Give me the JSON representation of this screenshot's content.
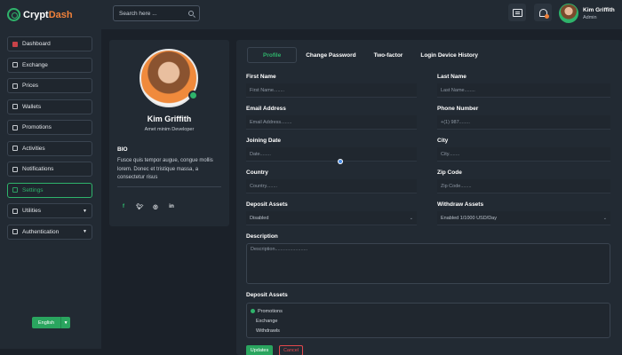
{
  "brand": {
    "prefix": "Crypt",
    "suffix": "Dash"
  },
  "search": {
    "placeholder": "Search here ..."
  },
  "header": {
    "user_name": "Kim Griffith",
    "user_role": "Admin"
  },
  "sidebar": {
    "items": [
      {
        "label": "Dashboard",
        "icon": "dashboard-icon"
      },
      {
        "label": "Exchange",
        "icon": "exchange-icon"
      },
      {
        "label": "Prices",
        "icon": "prices-icon"
      },
      {
        "label": "Wallets",
        "icon": "wallet-icon"
      },
      {
        "label": "Promotions",
        "icon": "percent-icon"
      },
      {
        "label": "Activities",
        "icon": "activity-icon"
      },
      {
        "label": "Notifications",
        "icon": "bell-icon"
      },
      {
        "label": "Settings",
        "icon": "settings-icon",
        "active": true
      },
      {
        "label": "Utilities",
        "icon": "utilities-icon"
      },
      {
        "label": "Authentication",
        "icon": "lock-icon"
      }
    ],
    "language": "English"
  },
  "profile": {
    "name": "Kim Griffith",
    "role": "Amet minim Developer",
    "bio_label": "BIO",
    "bio": "Fusce quis tempor augue, congue mollis lorem. Donec et tristique massa, a consectetur risus",
    "socials": [
      "f",
      "t",
      "ig",
      "in"
    ]
  },
  "tabs": [
    "Profile",
    "Change Password",
    "Two-factor",
    "Login Device History"
  ],
  "form": {
    "first_name": {
      "label": "First Name",
      "placeholder": "First Name........"
    },
    "last_name": {
      "label": "Last Name",
      "placeholder": "Last Name........"
    },
    "email": {
      "label": "Email Address",
      "placeholder": "Email Address........"
    },
    "phone": {
      "label": "Phone Number",
      "placeholder": "+(1) 987........"
    },
    "joining_date": {
      "label": "Joining Date",
      "placeholder": "Date........"
    },
    "city": {
      "label": "City",
      "placeholder": "City........"
    },
    "country": {
      "label": "Country",
      "placeholder": "Country........"
    },
    "zip": {
      "label": "Zip Code",
      "placeholder": "Zip Code........"
    },
    "deposit_select": {
      "label": "Deposit Assets",
      "value": "Disabled"
    },
    "withdraw_select": {
      "label": "Withdraw Assets",
      "value": "Enabled 1/1000 USD/Day"
    },
    "description": {
      "label": "Description",
      "placeholder": "Description........................"
    },
    "deposit_list": {
      "label": "Deposit Assets",
      "options": [
        "Promotions",
        "Exchange",
        "Withdrawls"
      ],
      "selected": "Promotions"
    },
    "update_label": "Updates",
    "cancel_label": "Cancel"
  },
  "colors": {
    "accent": "#2fb36b",
    "brand_suffix": "#f0813a",
    "danger": "#e5484d"
  }
}
